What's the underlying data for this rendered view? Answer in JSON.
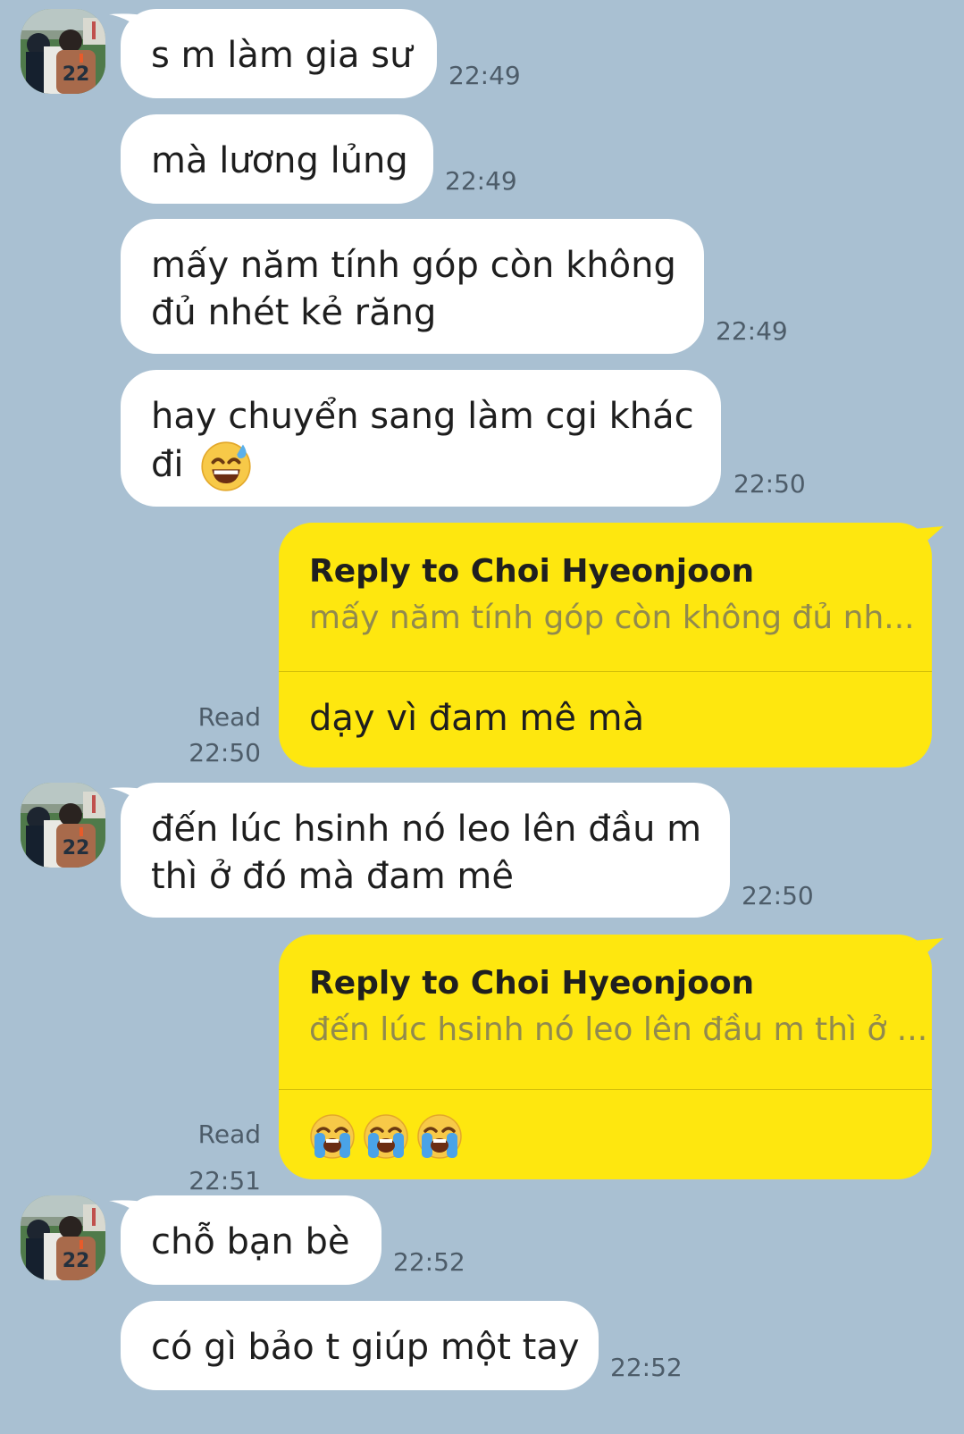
{
  "contact": {
    "name": "Choi Hyeonjoon",
    "avatar_label": "22"
  },
  "messages": [
    {
      "text": "s m làm gia sư",
      "time": "22:49"
    },
    {
      "text": "mà lương lủng",
      "time": "22:49"
    },
    {
      "line1": "mấy năm tính góp còn không",
      "line2": "đủ nhét kẻ răng",
      "time": "22:49"
    },
    {
      "line1": "hay chuyển sang làm cgi khác",
      "line2": "đi",
      "emoji": "grinning-sweat-emoji",
      "time": "22:50"
    },
    {
      "reply_title": "Reply to Choi Hyeonjoon",
      "reply_quote": "mấy năm tính góp còn không đủ nh...",
      "text": "dạy vì đam mê mà",
      "status": "Read",
      "time": "22:50"
    },
    {
      "line1": "đến lúc hsinh nó leo lên đầu m",
      "line2": "thì ở đó mà đam mê",
      "time": "22:50"
    },
    {
      "reply_title": "Reply to Choi Hyeonjoon",
      "reply_quote": "đến lúc hsinh nó leo lên đầu m thì ở ...",
      "emoji": [
        "crying-face-emoji",
        "crying-face-emoji",
        "crying-face-emoji"
      ],
      "status": "Read",
      "time": "22:51"
    },
    {
      "text": "chỗ bạn bè",
      "time": "22:52"
    },
    {
      "text": "có gì bảo t giúp một tay",
      "time": "22:52"
    }
  ],
  "colors": {
    "background": "#a9c0d2",
    "incoming_bubble": "#ffffff",
    "outgoing_bubble": "#fee70f",
    "timestamp": "#4d5c69",
    "quote_text": "#918a4e"
  }
}
